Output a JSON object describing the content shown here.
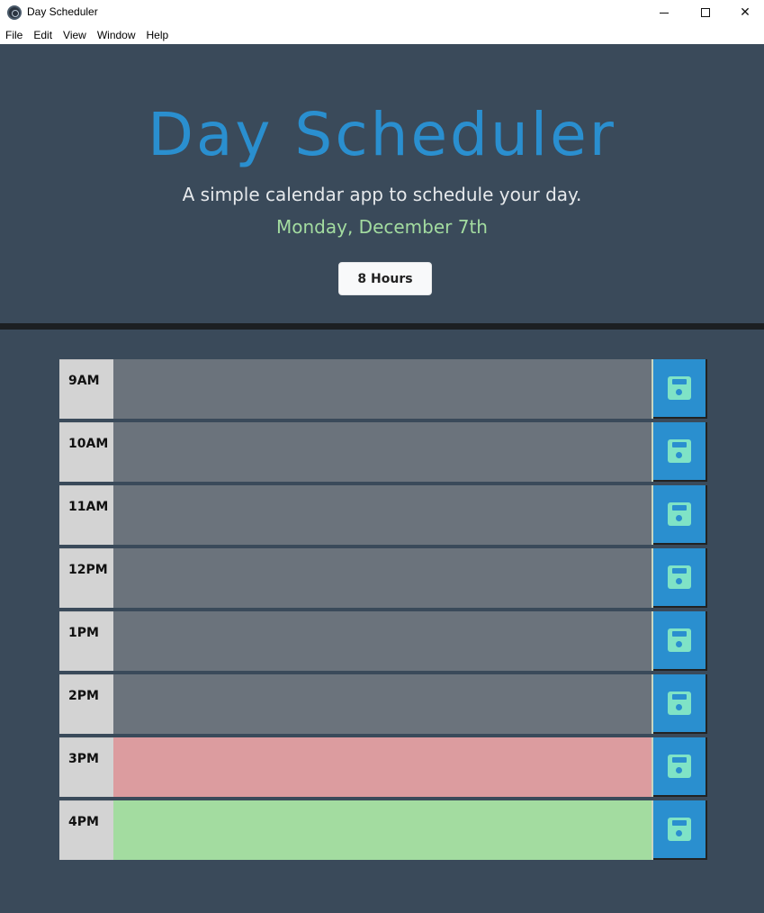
{
  "window": {
    "title": "Day Scheduler",
    "controls": {
      "minimize": "minimize",
      "maximize": "maximize",
      "close": "✕"
    }
  },
  "menu": [
    "File",
    "Edit",
    "View",
    "Window",
    "Help"
  ],
  "header": {
    "title": "Day Scheduler",
    "subtitle": "A simple calendar app to schedule your day.",
    "date": "Monday, December 7th",
    "hours_button": "8 Hours"
  },
  "schedule": [
    {
      "hour": "9AM",
      "text": "",
      "state": "past"
    },
    {
      "hour": "10AM",
      "text": "",
      "state": "past"
    },
    {
      "hour": "11AM",
      "text": "",
      "state": "past"
    },
    {
      "hour": "12PM",
      "text": "",
      "state": "past"
    },
    {
      "hour": "1PM",
      "text": "",
      "state": "past"
    },
    {
      "hour": "2PM",
      "text": "",
      "state": "past"
    },
    {
      "hour": "3PM",
      "text": "",
      "state": "present"
    },
    {
      "hour": "4PM",
      "text": "",
      "state": "future"
    }
  ],
  "icons": {
    "save": "floppy-disk-icon",
    "app": "app-icon"
  },
  "colors": {
    "background": "#3a4a5a",
    "title": "#2a8fcf",
    "date": "#a3dca0",
    "past": "#6b737c",
    "present": "#dc9c9f",
    "future": "#a3dca0",
    "save_button": "#2a8fcf",
    "save_icon": "#7fe3c6"
  }
}
